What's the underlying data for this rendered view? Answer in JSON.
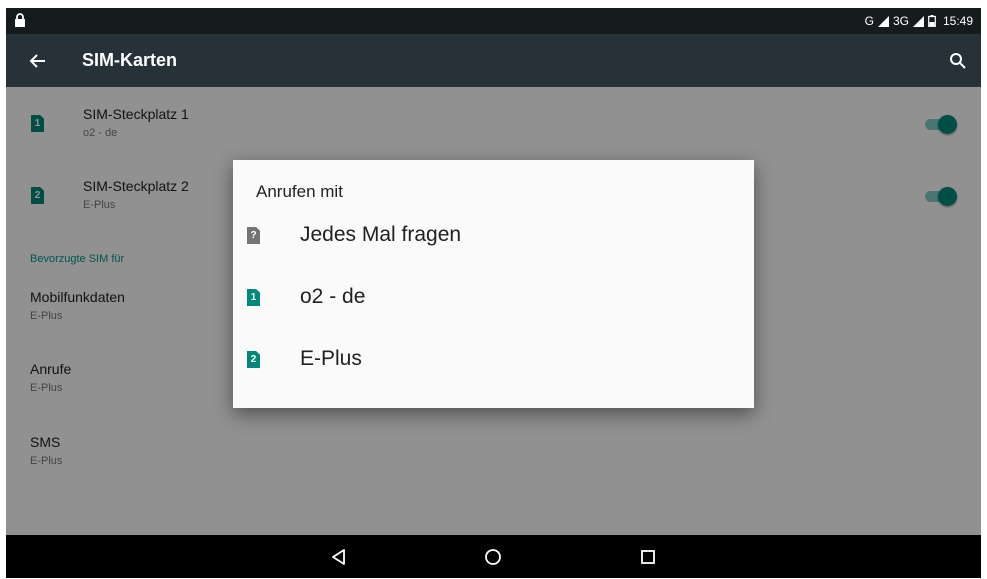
{
  "status_bar": {
    "net1": "G",
    "net2": "3G",
    "time": "15:49"
  },
  "toolbar": {
    "title": "SIM-Karten"
  },
  "sim_slots": [
    {
      "badge": "1",
      "title": "SIM-Steckplatz 1",
      "subtitle": "o2 - de",
      "enabled": true
    },
    {
      "badge": "2",
      "title": "SIM-Steckplatz 2",
      "subtitle": "E-Plus",
      "enabled": true
    }
  ],
  "section_header": "Bevorzugte SIM für",
  "prefs": [
    {
      "title": "Mobilfunkdaten",
      "value": "E-Plus"
    },
    {
      "title": "Anrufe",
      "value": "E-Plus"
    },
    {
      "title": "SMS",
      "value": "E-Plus"
    }
  ],
  "dialog": {
    "title": "Anrufen mit",
    "options": [
      {
        "badge": "?",
        "label": "Jedes Mal fragen"
      },
      {
        "badge": "1",
        "label": "o2 - de"
      },
      {
        "badge": "2",
        "label": "E-Plus"
      }
    ]
  },
  "colors": {
    "accent": "#00897b",
    "toolbar": "#263238",
    "statusbar": "#161b1d"
  }
}
